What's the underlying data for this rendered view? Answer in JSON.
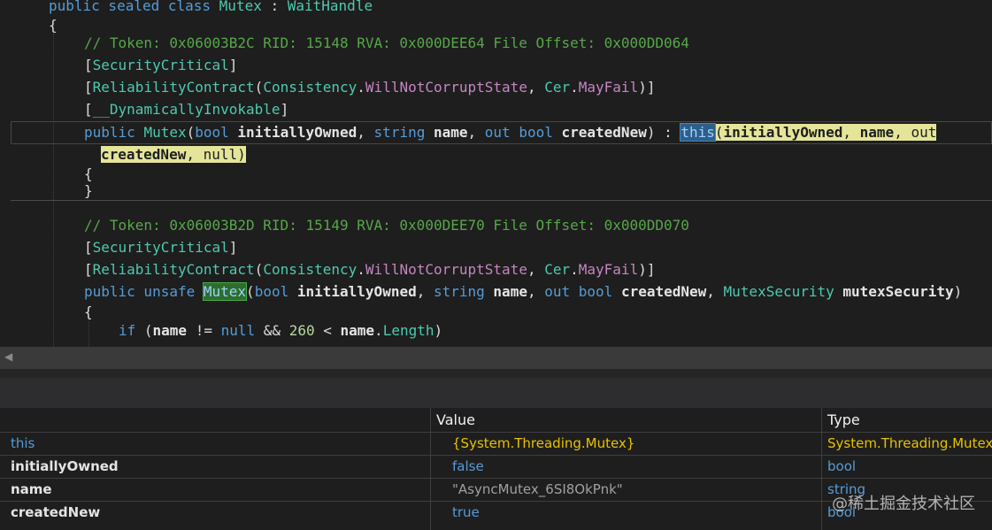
{
  "code": {
    "l_class": {
      "kw": "public sealed class",
      "name": "Mutex",
      "colon": " : ",
      "base": "WaitHandle"
    },
    "brace_open": "{",
    "brace_close": "}",
    "c1": {
      "comment": "// Token: 0x06003B2C RID: 15148 RVA: 0x000DEE64 File Offset: 0x000DD064"
    },
    "sec_attr": "SecurityCritical",
    "rel": {
      "name": "ReliabilityContract",
      "p1": "Consistency",
      "v1": "WillNotCorruptState",
      "p2": "Cer",
      "v2": "MayFail"
    },
    "dyn_attr": "__DynamicallyInvokable",
    "ctor1": {
      "public": "public",
      "name": "Mutex",
      "bool": "bool",
      "p1": "initiallyOwned",
      "string": "string",
      "p2": "name",
      "out": "out",
      "p3": "createdNew",
      "this": "this",
      "args_1": "initiallyOwned",
      "args_2": "name",
      "null": "null"
    },
    "c2": {
      "comment": "// Token: 0x06003B2D RID: 15149 RVA: 0x000DEE70 File Offset: 0x000DD070"
    },
    "ctor2": {
      "public_unsafe": "public unsafe",
      "name": "Mutex",
      "mtype": "MutexSecurity",
      "p4": "mutexSecurity"
    },
    "ifl": {
      "if": "if",
      "op1": "!=",
      "op2": "&&",
      "num": "260",
      "lt": "<",
      "prop": "Length"
    }
  },
  "locals": {
    "columns": {
      "name": "",
      "value": "Value",
      "type": "Type"
    },
    "rows": [
      {
        "name": "this",
        "value": "{System.Threading.Mutex}",
        "type": "System.Threading.Mutex"
      },
      {
        "name": "initiallyOwned",
        "value": "false",
        "type": "bool"
      },
      {
        "name": "name",
        "value": "\"AsyncMutex_6SI8OkPnk\"",
        "type": "string"
      },
      {
        "name": "createdNew",
        "value": "true",
        "type": "bool"
      }
    ]
  },
  "watermark": "@稀土掘金技术社区",
  "colors": {
    "keyword": "#569cd6",
    "type": "#4ec9b0",
    "comment": "#57a64a",
    "highlight": "#e5e59a",
    "value_yellow": "#e6c200"
  }
}
